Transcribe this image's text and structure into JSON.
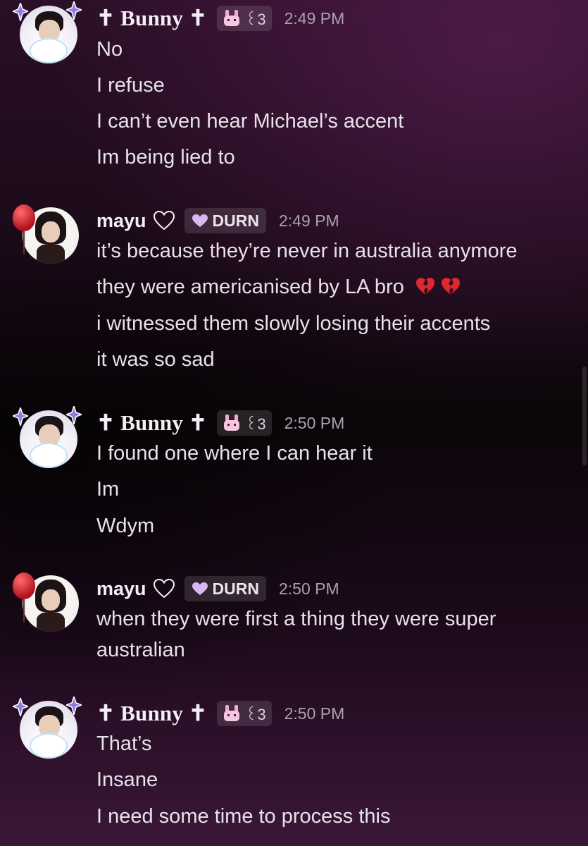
{
  "messages": [
    {
      "author": "✝ Bunny ✝",
      "tag": "꒰3",
      "time": "2:49 PM",
      "lines": [
        "No",
        "I refuse",
        "I can’t even hear Michael’s accent",
        "Im being lied to"
      ]
    },
    {
      "author": "mayu",
      "tag": "DURN",
      "time": "2:49 PM",
      "lines": [
        "it’s because they’re never in australia anymore",
        "they were americanised by LA bro",
        "i witnessed them slowly losing their accents",
        "it was so sad"
      ],
      "line_emoji": "broken-heart-icon x2"
    },
    {
      "author": "✝ Bunny ✝",
      "tag": "꒰3",
      "time": "2:50 PM",
      "lines": [
        "I found one where I can hear it",
        "Im",
        "Wdym"
      ]
    },
    {
      "author": "mayu",
      "tag": "DURN",
      "time": "2:50 PM",
      "lines": [
        "when they were first a thing they were super",
        "australian"
      ]
    },
    {
      "author": "✝ Bunny ✝",
      "tag": "꒰3",
      "time": "2:50 PM",
      "lines": [
        "That’s",
        "Insane",
        "I need some time to process this"
      ]
    }
  ],
  "colors": {
    "text": "#e7e2e9",
    "timestamp": "#a9a2ac",
    "tag_bg": "rgba(255,255,255,0.12)",
    "bunny_tag_icon": "#f3a9d4",
    "durn_heart": "#d9b8f2",
    "broken_heart": "#e0262f"
  }
}
